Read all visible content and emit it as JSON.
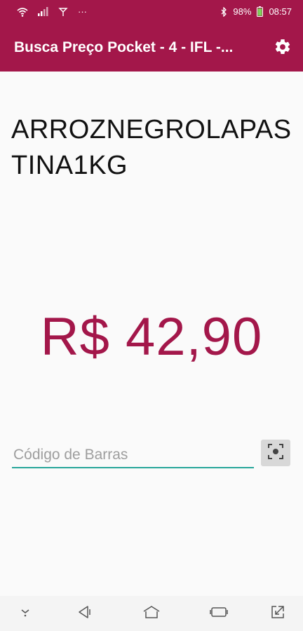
{
  "status_bar": {
    "battery": "98%",
    "time": "08:57",
    "overflow_dots": "···",
    "icons": [
      "wifi-icon",
      "signal-icon",
      "antenna-icon",
      "bluetooth-icon",
      "battery-icon"
    ]
  },
  "app_bar": {
    "title": "Busca Preço Pocket - 4 - IFL -...",
    "settings_icon": "gear-icon",
    "background": "#a3174a"
  },
  "product": {
    "name": "ARROZNEGROLAPASTINA1KG",
    "price": "R$ 42,90",
    "price_color": "#a3174a"
  },
  "barcode": {
    "placeholder": "Código de Barras",
    "value": "",
    "scan_icon": "scan-icon",
    "underline_color": "#26a69a"
  },
  "nav_bar": {
    "buttons": [
      "collapse-icon",
      "back-icon",
      "home-icon",
      "recents-icon",
      "resize-icon"
    ]
  }
}
